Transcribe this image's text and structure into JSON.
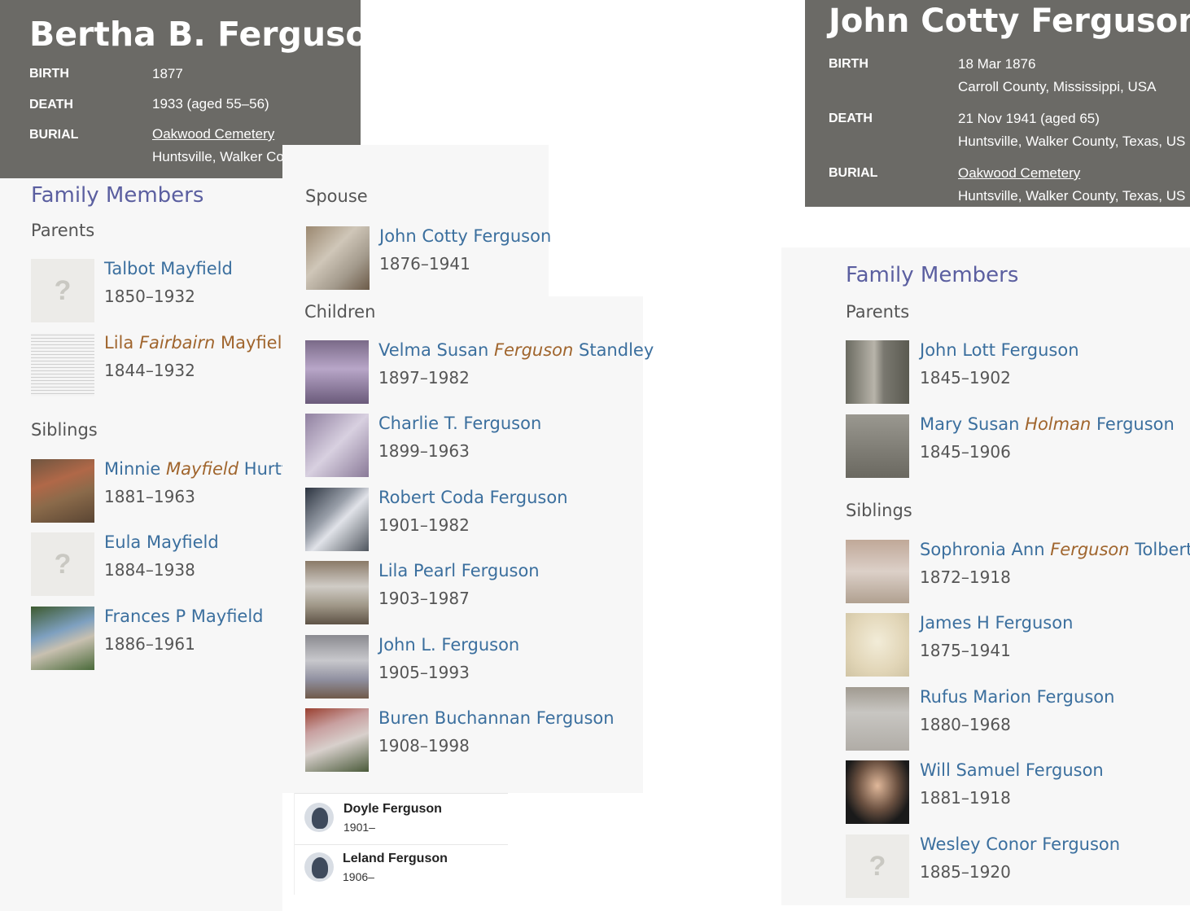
{
  "bertha": {
    "name": "Bertha B. Ferguson",
    "birth_label": "BIRTH",
    "birth": "1877",
    "death_label": "DEATH",
    "death": "1933 (aged 55–56)",
    "burial_label": "BURIAL",
    "burial_cemetery": "Oakwood Cemetery",
    "burial_place": "Huntsville, Walker County, Texas, U"
  },
  "bertha_family": {
    "title": "Family Members",
    "parents_title": "Parents",
    "parents": [
      {
        "name": "Talbot Mayfield",
        "dates": "1850–1932"
      },
      {
        "first": "Lila",
        "maiden": "Fairbairn",
        "last": "Mayfield",
        "dates": "1844–1932"
      }
    ],
    "siblings_title": "Siblings",
    "siblings": [
      {
        "first": "Minnie",
        "maiden": "Mayfield",
        "last": "Hurtt",
        "dates": "1881–1963"
      },
      {
        "name": "Eula Mayfield",
        "dates": "1884–1938"
      },
      {
        "name": "Frances P Mayfield",
        "dates": "1886–1961"
      }
    ]
  },
  "spouse_section": {
    "title": "Spouse",
    "spouse": {
      "name": "John Cotty Ferguson",
      "dates": "1876–1941"
    }
  },
  "children_section": {
    "title": "Children",
    "children": [
      {
        "first": "Velma Susan",
        "maiden": "Ferguson",
        "last": "Standley",
        "dates": "1897–1982"
      },
      {
        "name": "Charlie T. Ferguson",
        "dates": "1899–1963"
      },
      {
        "name": "Robert Coda Ferguson",
        "dates": "1901–1982"
      },
      {
        "name": "Lila Pearl Ferguson",
        "dates": "1903–1987"
      },
      {
        "name": "John L. Ferguson",
        "dates": "1905–1993"
      },
      {
        "name": "Buren Buchannan Ferguson",
        "dates": "1908–1998"
      }
    ]
  },
  "extra_children": [
    {
      "name": "Doyle Ferguson",
      "dates": "1901–"
    },
    {
      "name": "Leland Ferguson",
      "dates": "1906–"
    }
  ],
  "john": {
    "name": "John Cotty Ferguson",
    "birth_label": "BIRTH",
    "birth_date": "18 Mar 1876",
    "birth_place": "Carroll County, Mississippi, USA",
    "death_label": "DEATH",
    "death_date": "21 Nov 1941 (aged 65)",
    "death_place": "Huntsville, Walker County, Texas, US",
    "burial_label": "BURIAL",
    "burial_cemetery": "Oakwood Cemetery",
    "burial_place": "Huntsville, Walker County, Texas, US"
  },
  "john_family": {
    "title": "Family Members",
    "parents_title": "Parents",
    "parents": [
      {
        "name": "John Lott Ferguson",
        "dates": "1845–1902"
      },
      {
        "first": "Mary Susan",
        "maiden": "Holman",
        "last": "Ferguson",
        "dates": "1845–1906"
      }
    ],
    "siblings_title": "Siblings",
    "siblings": [
      {
        "first": "Sophronia Ann",
        "maiden": "Ferguson",
        "last": "Tolbert",
        "dates": "1872–1918"
      },
      {
        "name": "James H Ferguson",
        "dates": "1875–1941"
      },
      {
        "name": "Rufus Marion Ferguson",
        "dates": "1880–1968"
      },
      {
        "name": "Will Samuel Ferguson",
        "dates": "1881–1918"
      },
      {
        "name": "Wesley Conor Ferguson",
        "dates": "1885–1920"
      }
    ]
  },
  "icons": {
    "placeholder": "question-mark-icon",
    "avatar": "person-avatar-icon"
  },
  "colors": {
    "header_bg": "#6b6a66",
    "link": "#3b6f9e",
    "maiden": "#a0652d",
    "family_title": "#5b5fa0"
  }
}
